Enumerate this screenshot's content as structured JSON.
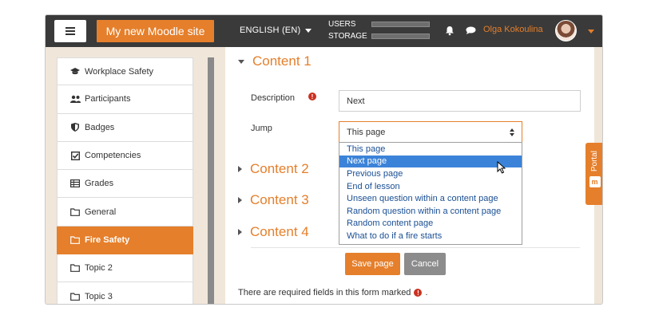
{
  "navbar": {
    "site_name": "My new Moodle site",
    "language": "ENGLISH (EN)",
    "usage": [
      {
        "label": "USERS",
        "fraction": 0.0
      },
      {
        "label": "STORAGE",
        "fraction": 0.0
      }
    ],
    "user_name": "Olga Kokoulina",
    "accent_color": "#e57f2b"
  },
  "sidebar": {
    "items": [
      {
        "label": "Workplace Safety",
        "icon": "graduation-cap-icon",
        "active": false
      },
      {
        "label": "Participants",
        "icon": "users-icon",
        "active": false
      },
      {
        "label": "Badges",
        "icon": "shield-icon",
        "active": false
      },
      {
        "label": "Competencies",
        "icon": "check-square-icon",
        "active": false
      },
      {
        "label": "Grades",
        "icon": "table-icon",
        "active": false
      },
      {
        "label": "General",
        "icon": "folder-icon",
        "active": false
      },
      {
        "label": "Fire Safety",
        "icon": "folder-icon",
        "active": true
      },
      {
        "label": "Topic 2",
        "icon": "folder-icon",
        "active": false
      },
      {
        "label": "Topic 3",
        "icon": "folder-icon",
        "active": false
      }
    ]
  },
  "form": {
    "sections": [
      "Content 1",
      "Content 2",
      "Content 3",
      "Content 4"
    ],
    "description_label": "Description",
    "description_value": "Next",
    "jump_label": "Jump",
    "jump_selected": "This page",
    "jump_options": [
      "This page",
      "Next page",
      "Previous page",
      "End of lesson",
      "Unseen question within a content page",
      "Random question within a content page",
      "Random content page",
      "What to do if a fire starts"
    ],
    "highlighted_option": "Next page",
    "save_label": "Save page",
    "cancel_label": "Cancel",
    "required_note": "There are required fields in this form marked",
    "required_note_end": "."
  },
  "portal": {
    "label": "Portal",
    "logo": "m"
  }
}
